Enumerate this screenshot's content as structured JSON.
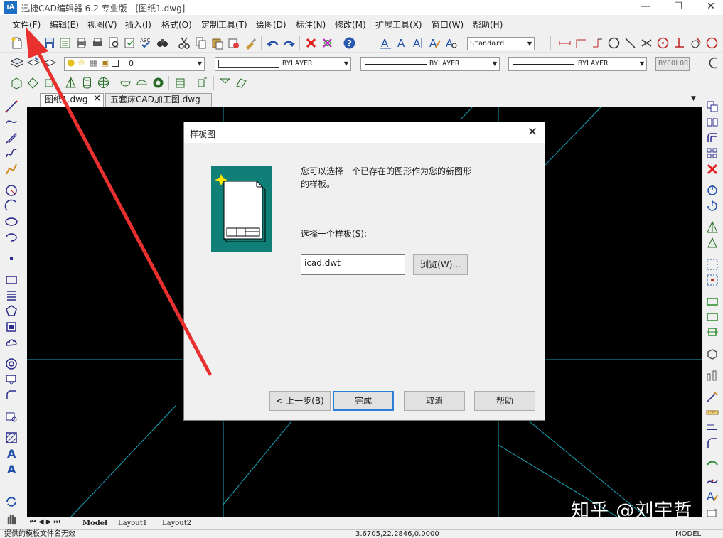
{
  "window": {
    "app_icon_text": "iA",
    "title": "迅捷CAD编辑器 6.2 专业版  - [图纸1.dwg]"
  },
  "menu": [
    "文件(F)",
    "编辑(E)",
    "视图(V)",
    "插入(I)",
    "格式(O)",
    "定制工具(T)",
    "绘图(D)",
    "标注(N)",
    "修改(M)",
    "扩展工具(X)",
    "窗口(W)",
    "帮助(H)"
  ],
  "toolbar": {
    "text_style": "Standard",
    "layer": "0",
    "color": "BYLAYER",
    "linetype": "BYLAYER",
    "lineweight": "BYLAYER",
    "plot_style": "BYCOLOR"
  },
  "tabs": [
    "图纸1.dwg",
    "五套床CAD加工图.dwg"
  ],
  "tab_close": "×",
  "layout_tabs": [
    "Model",
    "Layout1",
    "Layout2"
  ],
  "status": {
    "left": "提供的模板文件名无效",
    "coords": "3.6705,22.2846,0.0000",
    "mode": "MODEL"
  },
  "dialog": {
    "title": "样板图",
    "description": "您可以选择一个已存在的图形作为您的新图形的样板。",
    "select_label": "选择一个样板(S):",
    "template_value": "icad.dwt",
    "browse_button": "浏览(W)...",
    "back_button": "< 上一步(B)",
    "finish_button": "完成",
    "cancel_button": "取消",
    "help_button": "帮助"
  },
  "watermark": "知乎 @刘宇哲",
  "colors": {
    "canvas": "#000000",
    "canvas_lines": "#1aa3b8",
    "dialog_image_bg": "#0f7f78",
    "arrow": "#e8312f",
    "default_button_border": "#2b7fd8"
  }
}
